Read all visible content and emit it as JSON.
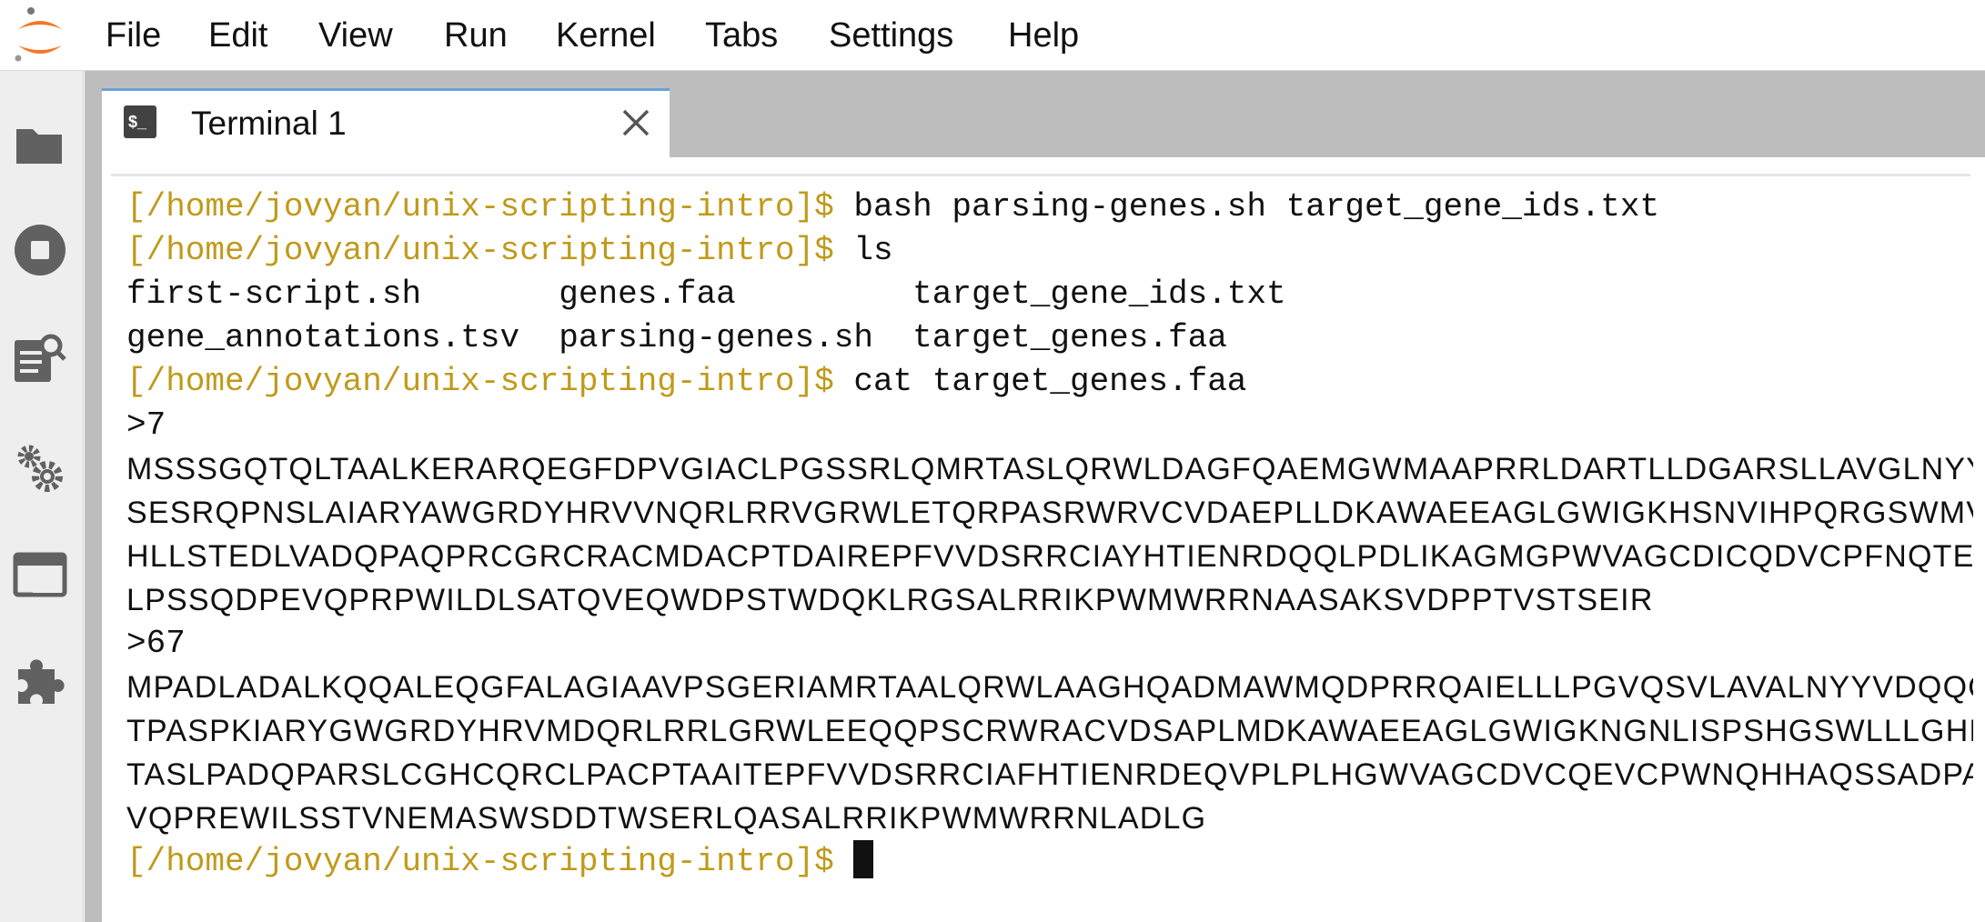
{
  "menu": [
    "File",
    "Edit",
    "View",
    "Run",
    "Kernel",
    "Tabs",
    "Settings",
    "Help"
  ],
  "sidebar_icons": [
    "folder-icon",
    "stop-circle-icon",
    "property-inspector-icon",
    "gears-icon",
    "tabs-icon",
    "extension-puzzle-icon"
  ],
  "tab": {
    "label": "Terminal 1",
    "icon_text": "$_"
  },
  "terminal": {
    "prompt": "[/home/jovyan/unix-scripting-intro]$",
    "cmd1": " bash parsing-genes.sh target_gene_ids.txt",
    "cmd2": " ls",
    "ls_row1": "first-script.sh       genes.faa         target_gene_ids.txt",
    "ls_row2": "gene_annotations.tsv  parsing-genes.sh  target_genes.faa",
    "cmd3": " cat target_genes.faa",
    "header1": ">7",
    "seq1": [
      "MSSSGQTQLTAALKERARQEGFDPVGIACLPGSSRLQMRTASLQRWLDAGFQAEMGWMAAPRRLDARTLLDGARSLLAVGLNYYV",
      "SESRQPNSLAIARYAWGRDYHRVVNQRLRRVGRWLETQRPASRWRVCVDAEPLLDKAWAEEAGLGWIGKHSNVIHPQRGSWMVIG",
      "HLLSTEDLVADQPAQPRCGRCRACMDACPTDAIREPFVVDSRRCIAYHTIENRDQQLPDLIKAGMGPWVAGCDICQDVCPFNQTE",
      "LPSSQDPEVQPRPWILDLSATQVEQWDPSTWDQKLRGSALRRIKPWMWRRNAASAKSVDPPTVSTSEIR"
    ],
    "header2": ">67",
    "seq2": [
      "MPADLADALKQQALEQGFALAGIAAVPSGERIAMRTAALQRWLAAGHQADMAWMQDPRRQAIELLLPGVQSVLAVALNYYVDQQQ",
      "TPASPKIARYGWGRDYHRVMDQRLRRLGRWLEEQQPSCRWRACVDSAPLMDKAWAEEAGLGWIGKNGNLISPSHGSWLLLGHLLT",
      "TASLPADQPARSLCGHCQRCLPACPTAAITEPFVVDSRRCIAFHTIENRDEQVPLPLHGWVAGCDVCQEVCPWNQHHAQSSADPA",
      "VQPREWILSSTVNEMASWSDDTWSERLQASALRRIKPWMWRRNLADLG"
    ]
  },
  "colors": {
    "prompt": "#c09a1a",
    "logo_orange": "#f37726",
    "icon_gray": "#616161",
    "tab_accent": "#6aa0d8"
  }
}
